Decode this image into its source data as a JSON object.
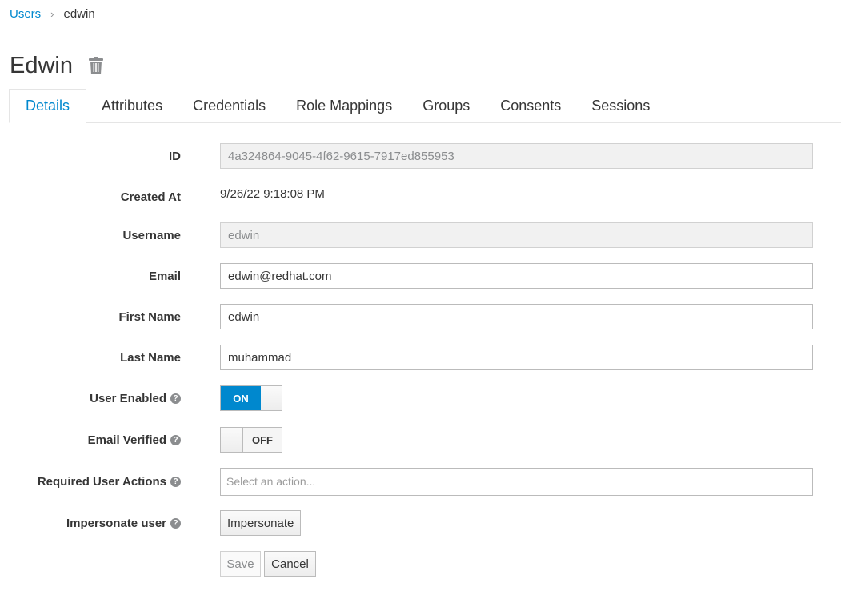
{
  "breadcrumb": {
    "parent": "Users",
    "separator": "›",
    "current": "edwin"
  },
  "header": {
    "title": "Edwin",
    "delete_icon": "trash-icon"
  },
  "tabs": [
    {
      "label": "Details",
      "active": true
    },
    {
      "label": "Attributes"
    },
    {
      "label": "Credentials"
    },
    {
      "label": "Role Mappings"
    },
    {
      "label": "Groups"
    },
    {
      "label": "Consents"
    },
    {
      "label": "Sessions"
    }
  ],
  "form": {
    "id": {
      "label": "ID",
      "value": "4a324864-9045-4f62-9615-7917ed855953"
    },
    "created_at": {
      "label": "Created At",
      "value": "9/26/22 9:18:08 PM"
    },
    "username": {
      "label": "Username",
      "value": "edwin"
    },
    "email": {
      "label": "Email",
      "value": "edwin@redhat.com"
    },
    "first_name": {
      "label": "First Name",
      "value": "edwin"
    },
    "last_name": {
      "label": "Last Name",
      "value": "muhammad"
    },
    "user_enabled": {
      "label": "User Enabled",
      "state": "ON"
    },
    "email_verified": {
      "label": "Email Verified",
      "state": "OFF"
    },
    "required_actions": {
      "label": "Required User Actions",
      "placeholder": "Select an action..."
    },
    "impersonate": {
      "label": "Impersonate user",
      "button": "Impersonate"
    },
    "help_glyph": "?"
  },
  "actions": {
    "save": "Save",
    "cancel": "Cancel"
  },
  "colors": {
    "accent": "#0088ce",
    "text": "#363636",
    "muted": "#8b8d8f"
  }
}
